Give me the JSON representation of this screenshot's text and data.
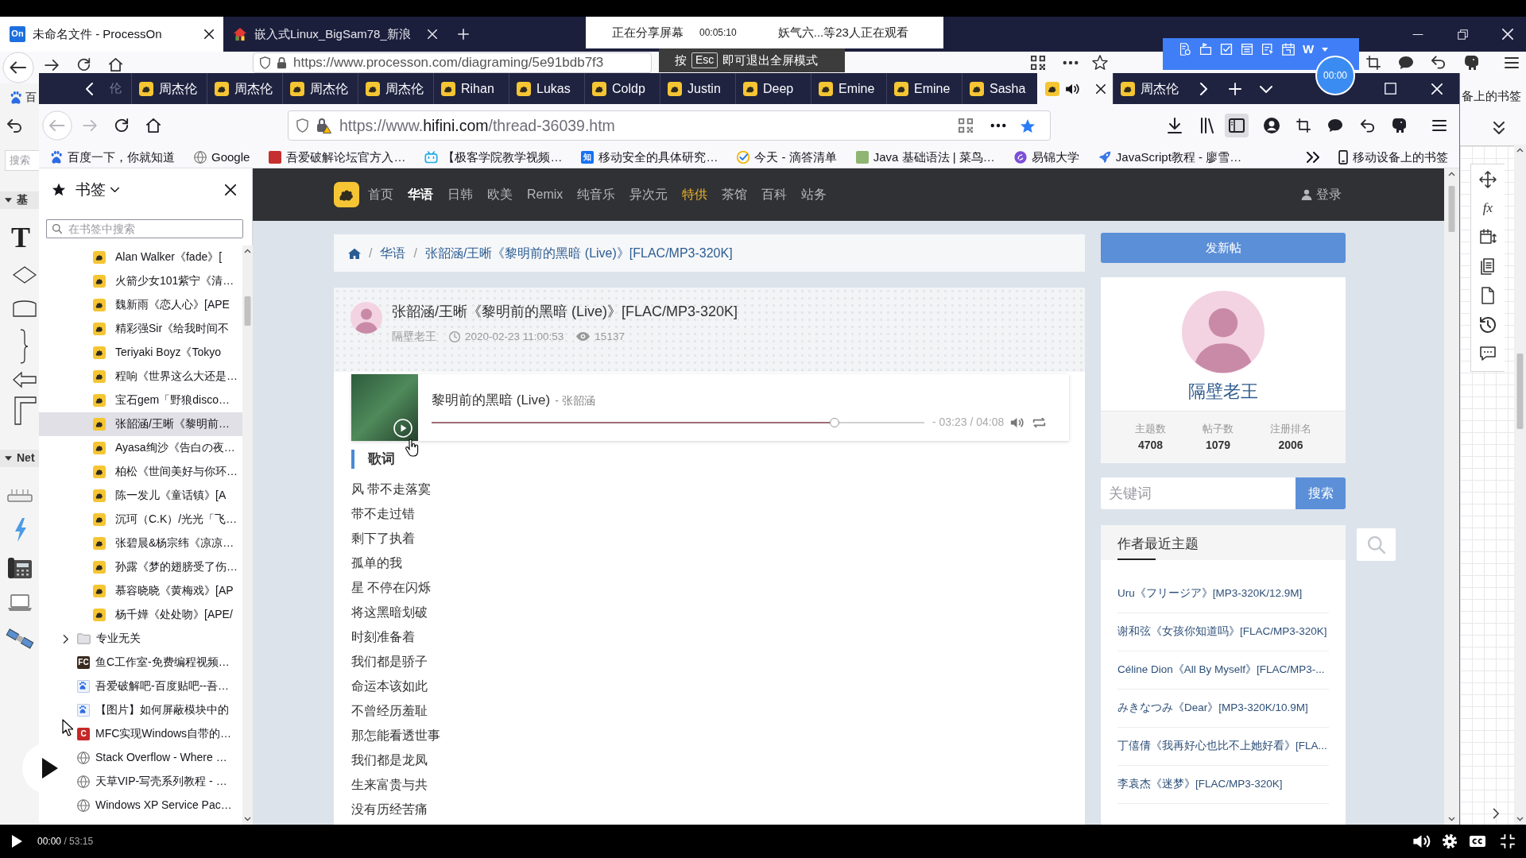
{
  "outer_browser": {
    "tabs": [
      {
        "title": "未命名文件 - ProcessOn",
        "favicon_text": "On",
        "selected": true
      },
      {
        "title": "嵌入式Linux_BigSam78_新浪",
        "selected": false
      }
    ],
    "url": "https://www.processon.com/diagraming/5e91bdb7f3",
    "bookmark_fragment_left": "百",
    "bookmark_fragment_right": "备上的书签"
  },
  "screen_share": {
    "label": "正在分享屏幕",
    "time": "00:05:10",
    "viewers": "妖气六...等23人正在观看"
  },
  "fullscreen_notice": {
    "before": "按",
    "key": "Esc",
    "after": "即可退出全屏模式"
  },
  "recorder": {
    "logo": "W",
    "timer": "00:00"
  },
  "diagram_editor": {
    "search_placeholder": "搜索",
    "sections": [
      {
        "title": "基",
        "expanded": true
      },
      {
        "title": "Net",
        "expanded": true
      }
    ],
    "text_tool": "T",
    "formula_tool": "fx"
  },
  "browser": {
    "scrolled_tab_fragment": "伦",
    "tabs": [
      {
        "title": "周杰伦",
        "selected": false,
        "audio": false
      },
      {
        "title": "周杰伦",
        "selected": false,
        "audio": false
      },
      {
        "title": "周杰伦",
        "selected": false,
        "audio": false
      },
      {
        "title": "周杰伦",
        "selected": false,
        "audio": false
      },
      {
        "title": "Rihan",
        "selected": false,
        "audio": false
      },
      {
        "title": "Lukas",
        "selected": false,
        "audio": false
      },
      {
        "title": "Coldp",
        "selected": false,
        "audio": false
      },
      {
        "title": "Justin",
        "selected": false,
        "audio": false
      },
      {
        "title": "Deep",
        "selected": false,
        "audio": false
      },
      {
        "title": "Emine",
        "selected": false,
        "audio": false
      },
      {
        "title": "Emine",
        "selected": false,
        "audio": false
      },
      {
        "title": "Sasha",
        "selected": false,
        "audio": false
      },
      {
        "selected": true,
        "audio": true
      },
      {
        "title": "周杰伦",
        "selected": false,
        "audio": false
      }
    ],
    "url": {
      "prefix": "https://www.",
      "domain": "hifini.com",
      "path": "/thread-36039.htm"
    },
    "bookmarked": true,
    "bookmarks_bar": [
      {
        "title": "百度一下，你就知道",
        "kind": "paw"
      },
      {
        "title": "Google",
        "kind": "globe"
      },
      {
        "title": "吾爱破解论坛官方入…",
        "kind": "tile",
        "color": "#c62f2f"
      },
      {
        "title": "【极客学院教学视频…",
        "kind": "tv"
      },
      {
        "title": "移动安全的具体研究…",
        "kind": "letter",
        "badge": "知",
        "color": "#1772f6"
      },
      {
        "title": "今天 - 滴答清单",
        "kind": "check"
      },
      {
        "title": "Java 基础语法 | 菜鸟…",
        "kind": "tile",
        "color": "#8fb573"
      },
      {
        "title": "易锦大学",
        "kind": "swirl"
      },
      {
        "title": "JavaScript教程 - 廖雪…",
        "kind": "rocket"
      }
    ],
    "mobile_bookmarks": "移动设备上的书签"
  },
  "bookmarks_sidebar": {
    "title": "书签",
    "search_placeholder": "在书签中搜索",
    "tree": [
      {
        "children": [
          {
            "title": "Alan Walker《fade》[",
            "kind": "song",
            "selected": false
          },
          {
            "title": "火箭少女101紫宁《清…",
            "kind": "song",
            "selected": false
          },
          {
            "title": "魏新雨《恋人心》[APE",
            "kind": "song",
            "selected": false
          },
          {
            "title": "精彩强Sir《给我时间不",
            "kind": "song",
            "selected": false
          },
          {
            "title": "Teriyaki Boyz《Tokyo",
            "kind": "song",
            "selected": false
          },
          {
            "title": "程响《世界这么大还是…",
            "kind": "song",
            "selected": false
          },
          {
            "title": "宝石gem「野狼disco…",
            "kind": "song",
            "selected": false
          },
          {
            "title": "张韶涵/王晰《黎明前…",
            "kind": "song",
            "selected": true
          },
          {
            "title": "Ayasa绚沙《告白の夜…",
            "kind": "song",
            "selected": false
          },
          {
            "title": "柏松《世间美好与你环…",
            "kind": "song",
            "selected": false
          },
          {
            "title": "陈一发儿《童话镇》[A",
            "kind": "song",
            "selected": false
          },
          {
            "title": "沉珂（C.K）/光光「飞…",
            "kind": "song",
            "selected": false
          },
          {
            "title": "张碧晨&杨宗纬《凉凉…",
            "kind": "song",
            "selected": false
          },
          {
            "title": "孙露《梦的翅膀受了伤…",
            "kind": "song",
            "selected": false
          },
          {
            "title": "慕容晓晓《黄梅戏》[AP",
            "kind": "song",
            "selected": false
          },
          {
            "title": "杨千嬅《处处吻》[APE/",
            "kind": "song",
            "selected": false
          }
        ]
      },
      {
        "title": "专业无关",
        "kind": "folder",
        "expanded": false,
        "selected": false
      },
      {
        "title": "鱼C工作室-免费编程视频…",
        "kind": "letter",
        "badge": "FC",
        "color": "#3a2a1e",
        "selected": false
      },
      {
        "title": "吾爱破解吧-百度贴吧--吾…",
        "kind": "pawtile",
        "selected": false
      },
      {
        "title": "【图片】如何屏蔽模块中的",
        "kind": "pawtile",
        "selected": false
      },
      {
        "title": "MFC实现Windows自带的…",
        "kind": "letter",
        "badge": "C",
        "color": "#c62828",
        "selected": false
      },
      {
        "title": "Stack Overflow - Where …",
        "kind": "globe",
        "selected": false
      },
      {
        "title": "天草VIP-写壳系列教程 - …",
        "kind": "globe",
        "selected": false
      },
      {
        "title": "Windows XP Service Pac…",
        "kind": "globe",
        "selected": false
      }
    ]
  },
  "site": {
    "nav": [
      {
        "label": "首页",
        "selected": false,
        "featured": false
      },
      {
        "label": "华语",
        "selected": true,
        "featured": false
      },
      {
        "label": "日韩",
        "selected": false,
        "featured": false
      },
      {
        "label": "欧美",
        "selected": false,
        "featured": false
      },
      {
        "label": "Remix",
        "selected": false,
        "featured": false
      },
      {
        "label": "纯音乐",
        "selected": false,
        "featured": false
      },
      {
        "label": "异次元",
        "selected": false,
        "featured": false
      },
      {
        "label": "特供",
        "selected": false,
        "featured": true
      },
      {
        "label": "茶馆",
        "selected": false,
        "featured": false
      },
      {
        "label": "百科",
        "selected": false,
        "featured": false
      },
      {
        "label": "站务",
        "selected": false,
        "featured": false
      }
    ],
    "login": "登录"
  },
  "breadcrumb": {
    "items": [
      {
        "separator": "/",
        "label": "华语"
      },
      {
        "separator": "/",
        "label": "张韶涵/王晰《黎明前的黑暗 (Live)》[FLAC/MP3-320K]"
      }
    ]
  },
  "post": {
    "title": "张韶涵/王晰《黎明前的黑暗 (Live)》[FLAC/MP3-320K]",
    "author": "隔壁老王",
    "time": "2020-02-23 11:00:53",
    "views": "15137",
    "player": {
      "title": "黎明前的黑暗 (Live)",
      "artist": "- 张韶涵",
      "level": 0.818,
      "time": "- 03:23 / 04:08"
    },
    "lyrics_heading": "歌词",
    "lyrics": [
      "风 带不走落寞",
      "带不走过错",
      "剩下了执着",
      "孤单的我",
      "星 不停在闪烁",
      "将这黑暗划破",
      "时刻准备着",
      "我们都是骄子",
      "命运本该如此",
      "不曾经历羞耻",
      "那怎能看透世事",
      "我们都是龙凤",
      "生来富贵与共",
      "没有历经苦痛"
    ]
  },
  "side_panel": {
    "new_post": "发新帖",
    "user": {
      "name": "隔壁老王",
      "stats": [
        {
          "label": "主题数",
          "value": "4708"
        },
        {
          "label": "帖子数",
          "value": "1079"
        },
        {
          "label": "注册排名",
          "value": "2006"
        }
      ]
    },
    "search": {
      "placeholder": "关键词",
      "button": "搜索"
    },
    "recent": {
      "title": "作者最近主题",
      "items": [
        "Uru《フリージア》[MP3-320K/12.9M]",
        "谢和弦《女孩你知道吗》[FLAC/MP3-320K]",
        "Céline Dion《All By Myself》[FLAC/MP3-...",
        "みきなつみ《Dear》[MP3-320K/10.9M]",
        "丁僖倩《我再好心也比不上她好看》[FLA...",
        "李袁杰《迷梦》[FLAC/MP3-320K]"
      ]
    }
  },
  "video_player": {
    "elapsed": "00:00",
    "total": "/ 53:15"
  }
}
